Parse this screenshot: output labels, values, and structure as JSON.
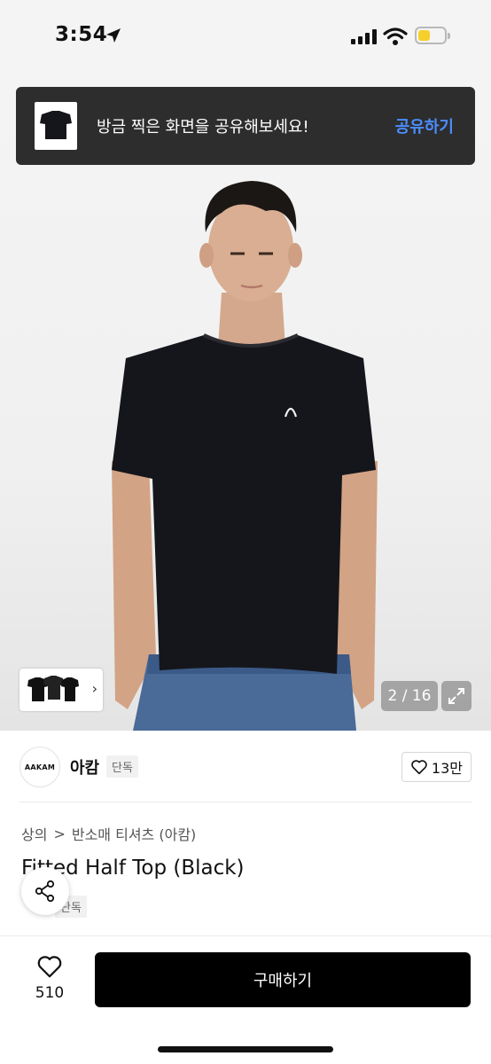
{
  "status_bar": {
    "time": "3:54"
  },
  "share_banner": {
    "message": "방금 찍은 화면을 공유해보세요!",
    "action": "공유하기"
  },
  "gallery": {
    "counter": "2 / 16"
  },
  "brand": {
    "logo_text": "AAKAM",
    "name": "아캄",
    "badge": "단독",
    "likes": "13만"
  },
  "breadcrumb": {
    "category": "상의",
    "separator": ">",
    "subcategory": "반소매 티셔츠 (아캄)"
  },
  "product": {
    "title": "Fitted Half Top (Black)",
    "badge": "단독"
  },
  "bottom_bar": {
    "wish_count": "510",
    "buy_label": "구매하기"
  },
  "colors": {
    "accent": "#4b8dff",
    "banner_bg": "#2d2d2d",
    "buy_bg": "#000000",
    "battery": "#f6cf2c"
  }
}
